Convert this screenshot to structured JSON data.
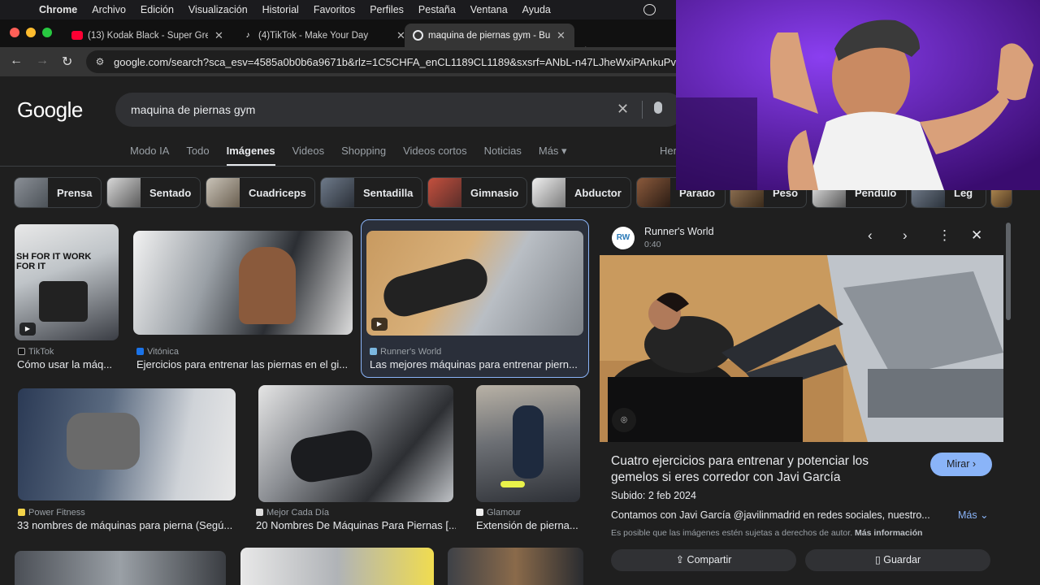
{
  "menubar": {
    "app": "Chrome",
    "items": [
      "Archivo",
      "Edición",
      "Visualización",
      "Historial",
      "Favoritos",
      "Perfiles",
      "Pestaña",
      "Ventana",
      "Ayuda"
    ]
  },
  "tabs": [
    {
      "label": "(13) Kodak Black - Super Gre",
      "favicon": "youtube-icon"
    },
    {
      "label": "(4)TikTok - Make Your Day",
      "favicon": "tiktok-icon"
    },
    {
      "label": "maquina de piernas gym - Bu",
      "favicon": "google-icon"
    }
  ],
  "address": {
    "url": "google.com/search?sca_esv=4585a0b0b6a9671b&rlz=1C5CHFA_enCL1189CL1189&sxsrf=ANbL-n47LJheWxiPAnkuPv"
  },
  "google": {
    "logo": "Google",
    "query": "maquina de piernas gym",
    "nav": [
      "Modo IA",
      "Todo",
      "Imágenes",
      "Videos",
      "Shopping",
      "Videos cortos",
      "Noticias",
      "Más ▾"
    ],
    "nav_active": "Imágenes",
    "nav_right": "Her",
    "chips": [
      "Prensa",
      "Sentado",
      "Cuadriceps",
      "Sentadilla",
      "Gimnasio",
      "Abductor",
      "Parado",
      "Peso",
      "Pendulo",
      "Leg"
    ]
  },
  "results": [
    {
      "source": "TikTok",
      "title": "Cómo usar la máq..."
    },
    {
      "source": "Vitónica",
      "title": "Ejercicios para entrenar las piernas en el gi..."
    },
    {
      "source": "Runner's World",
      "title": "Las mejores máquinas para entrenar piern..."
    },
    {
      "source": "Power Fitness",
      "title": "33 nombres de máquinas para pierna (Segú..."
    },
    {
      "source": "Mejor Cada Día",
      "title": "20 Nombres De Máquinas Para Piernas [..."
    },
    {
      "source": "Glamour",
      "title": "Extensión de pierna..."
    }
  ],
  "thumb_texts": {
    "tiktok_overlay": "SH FOR IT WORK FOR IT"
  },
  "panel": {
    "source": "Runner's World",
    "favicon_text": "RW",
    "duration": "0:40",
    "title": "Cuatro ejercicios para entrenar y potenciar los gemelos si eres corredor con Javi García",
    "watch": "Mirar",
    "uploaded": "Subido: 2 feb 2024",
    "description": "Contamos con Javi García @javilinmadrid en redes sociales, nuestro...",
    "more": "Más",
    "copyright": "Es posible que las imágenes estén sujetas a derechos de autor.",
    "more_info": "Más información",
    "share": "Compartir",
    "save": "Guardar"
  },
  "colors": {
    "accent": "#8ab4f8",
    "page_bg": "#1f1f1f",
    "cam_bg": "#5a17a8"
  }
}
